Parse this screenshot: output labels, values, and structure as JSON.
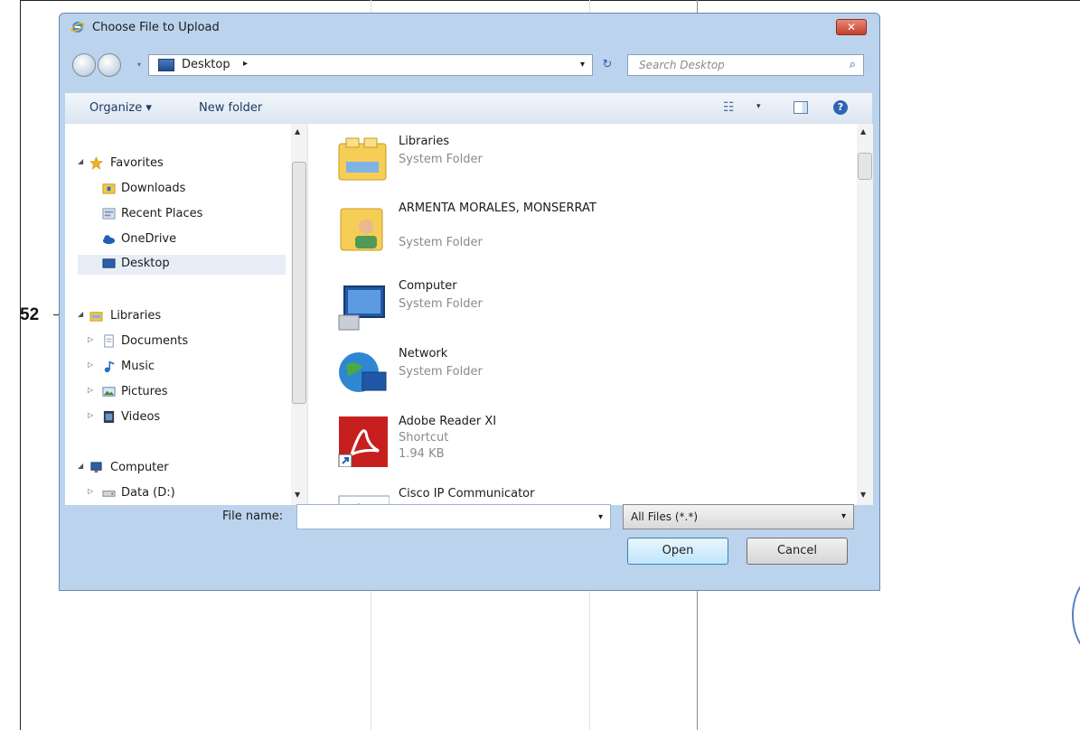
{
  "annotation": {
    "callout_number": "52"
  },
  "dialog": {
    "title": "Choose File to Upload",
    "close_symbol": "✕",
    "address": {
      "location": "Desktop",
      "chevron": "▸",
      "dropdown": "▾",
      "refresh_symbol": "↻"
    },
    "search": {
      "placeholder": "Search Desktop",
      "icon": "⌕"
    },
    "toolbar": {
      "organize": "Organize ▾",
      "new_folder": "New folder",
      "views_symbol": "☷",
      "views_dropdown": "▾",
      "help_symbol": "?"
    },
    "nav_pane": {
      "favorites": {
        "label": "Favorites",
        "items": [
          "Downloads",
          "Recent Places",
          "OneDrive",
          "Desktop"
        ]
      },
      "libraries": {
        "label": "Libraries",
        "items": [
          "Documents",
          "Music",
          "Pictures",
          "Videos"
        ]
      },
      "computer": {
        "label": "Computer",
        "items": [
          "Data (D:)"
        ]
      },
      "selected_item": "Desktop"
    },
    "files": [
      {
        "name": "Libraries",
        "type": "System Folder",
        "size": ""
      },
      {
        "name": "ARMENTA MORALES, MONSERRAT",
        "type": "System Folder",
        "size": ""
      },
      {
        "name": "Computer",
        "type": "System Folder",
        "size": ""
      },
      {
        "name": "Network",
        "type": "System Folder",
        "size": ""
      },
      {
        "name": "Adobe Reader XI",
        "type": "Shortcut",
        "size": "1.94 KB"
      },
      {
        "name": "Cisco IP Communicator",
        "type": "",
        "size": ""
      }
    ],
    "footer": {
      "file_name_label": "File name:",
      "file_name_value": "",
      "file_type_filter": "All Files (*.*)",
      "open_button": "Open",
      "cancel_button": "Cancel"
    }
  },
  "colors": {
    "dialog_chrome": "#bcd3ee",
    "close_red": "#c4402a",
    "open_button_blue": "#bee6fd",
    "accent_blue": "#2f65b3"
  }
}
